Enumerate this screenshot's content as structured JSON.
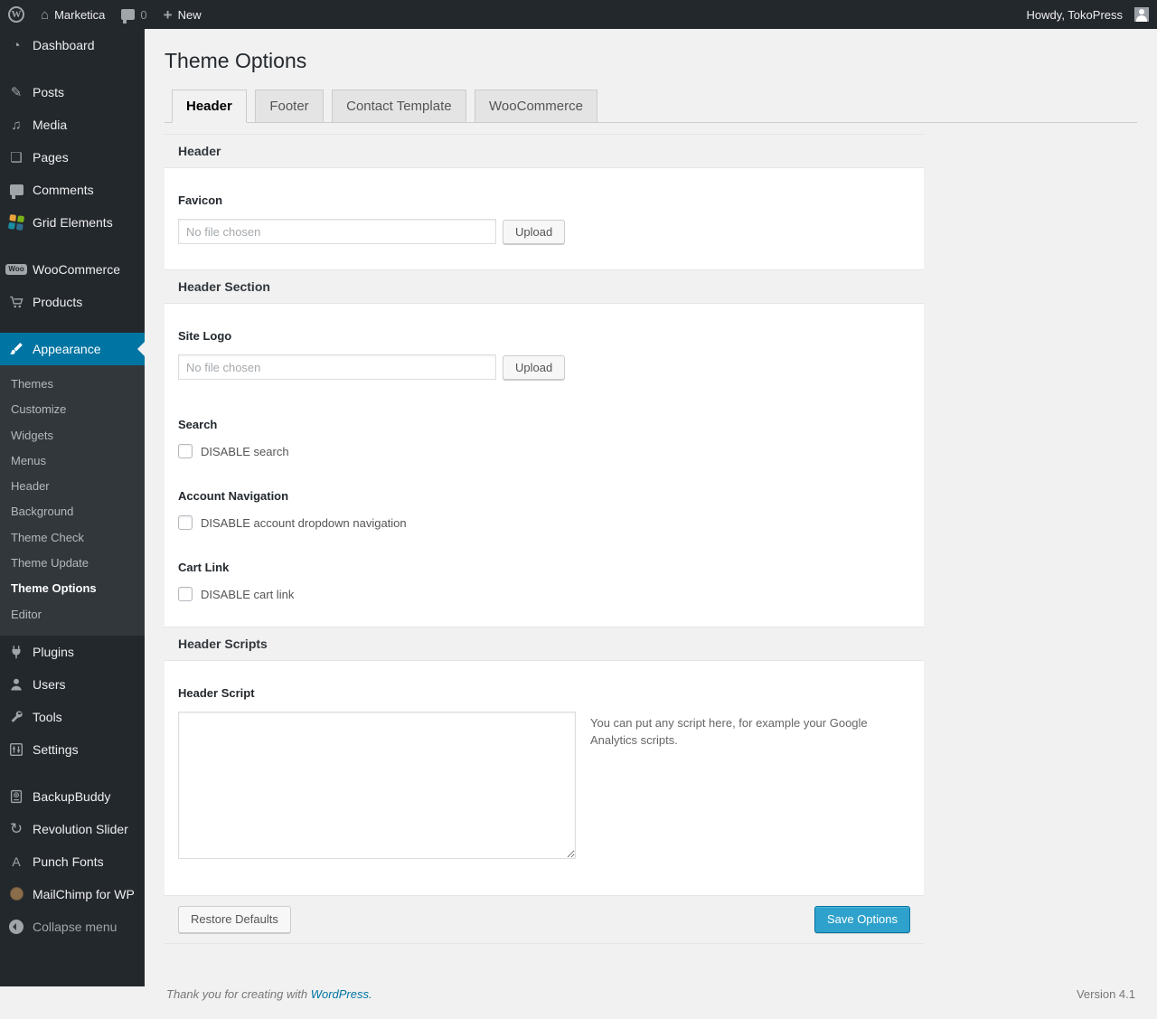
{
  "colors": {
    "adminbar_bg": "#23282d",
    "sidebar_bg": "#23282d",
    "submenu_bg": "#32373c",
    "active_menu_bg": "#0074a2",
    "content_bg": "#f1f1f1",
    "primary_button_bg": "#2ea2cc",
    "primary_button_border": "#0074a2",
    "link_blue": "#0074a2"
  },
  "icons": {
    "logo": "W",
    "home": "⌂",
    "plus": "+",
    "dashboard": "◔",
    "posts": "✎",
    "media": "♫",
    "pages": "❏",
    "revolution_slider": "↻",
    "punch_fonts": "A",
    "woo_badge": "Woo"
  },
  "admin_bar": {
    "site_name": "Marketica",
    "comment_count": "0",
    "new_label": "New",
    "howdy_text": "Howdy, TokoPress"
  },
  "sidebar": {
    "items": {
      "dashboard": {
        "label": "Dashboard"
      },
      "posts": {
        "label": "Posts"
      },
      "media": {
        "label": "Media"
      },
      "pages": {
        "label": "Pages"
      },
      "comments": {
        "label": "Comments"
      },
      "grid_elements": {
        "label": "Grid Elements"
      },
      "woocommerce": {
        "label": "WooCommerce"
      },
      "products": {
        "label": "Products"
      },
      "appearance": {
        "label": "Appearance",
        "active": true
      },
      "plugins": {
        "label": "Plugins"
      },
      "users": {
        "label": "Users"
      },
      "tools": {
        "label": "Tools"
      },
      "settings": {
        "label": "Settings"
      },
      "backupbuddy": {
        "label": "BackupBuddy"
      },
      "revolution_slider": {
        "label": "Revolution Slider"
      },
      "punch_fonts": {
        "label": "Punch Fonts"
      },
      "mailchimp": {
        "label": "MailChimp for WP"
      }
    },
    "submenu": [
      {
        "label": "Themes"
      },
      {
        "label": "Customize"
      },
      {
        "label": "Widgets"
      },
      {
        "label": "Menus"
      },
      {
        "label": "Header"
      },
      {
        "label": "Background"
      },
      {
        "label": "Theme Check"
      },
      {
        "label": "Theme Update"
      },
      {
        "label": "Theme Options",
        "current": true
      },
      {
        "label": "Editor"
      }
    ],
    "collapse_label": "Collapse menu"
  },
  "page": {
    "title": "Theme Options"
  },
  "tabs": [
    {
      "label": "Header",
      "active": true
    },
    {
      "label": "Footer",
      "active": false
    },
    {
      "label": "Contact Template",
      "active": false
    },
    {
      "label": "WooCommerce",
      "active": false
    }
  ],
  "panel": {
    "section_header": {
      "title": "Header"
    },
    "favicon": {
      "label": "Favicon",
      "file_placeholder": "No file chosen",
      "upload_label": "Upload"
    },
    "section_header_section": {
      "title": "Header Section"
    },
    "site_logo": {
      "label": "Site Logo",
      "file_placeholder": "No file chosen",
      "upload_label": "Upload"
    },
    "search": {
      "label": "Search",
      "checkbox_label": "DISABLE search",
      "checked": false
    },
    "account_navigation": {
      "label": "Account Navigation",
      "checkbox_label": "DISABLE account dropdown navigation",
      "checked": false
    },
    "cart_link": {
      "label": "Cart Link",
      "checkbox_label": "DISABLE cart link",
      "checked": false
    },
    "section_header_scripts": {
      "title": "Header Scripts"
    },
    "header_script": {
      "label": "Header Script",
      "value": "",
      "help_text": "You can put any script here, for example your Google Analytics scripts."
    },
    "footer": {
      "restore_label": "Restore Defaults",
      "save_label": "Save Options"
    }
  },
  "page_footer": {
    "thanks_text": "Thank you for creating with ",
    "wordpress_link": "WordPress.",
    "version": "Version 4.1"
  }
}
